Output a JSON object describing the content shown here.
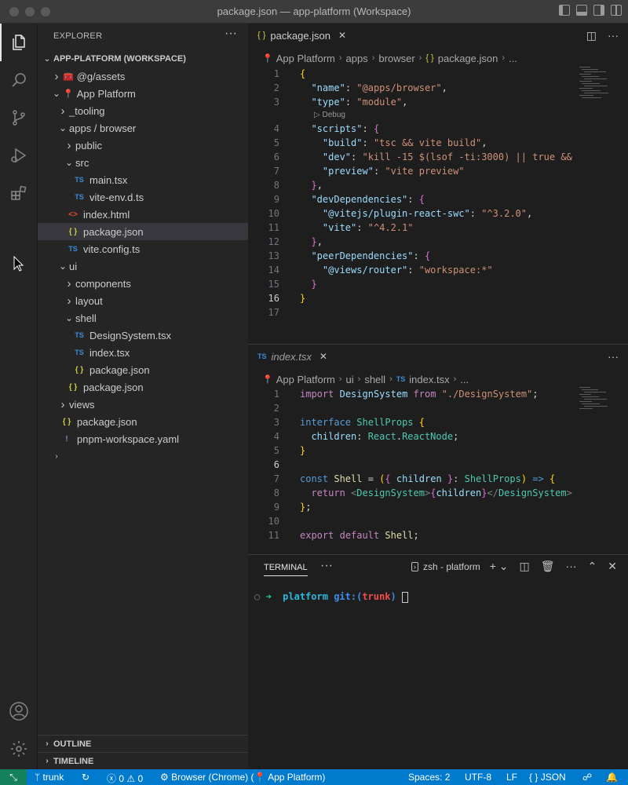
{
  "window": {
    "title": "package.json — app-platform (Workspace)"
  },
  "explorer": {
    "title": "EXPLORER",
    "more": "···",
    "workspace": "APP-PLATFORM (WORKSPACE)",
    "tree": [
      {
        "label": "@g/assets",
        "kind": "folder",
        "icon": "🧰"
      },
      {
        "label": "App Platform",
        "kind": "folder-open",
        "icon": "📍"
      },
      {
        "label": "_tooling",
        "kind": "folder"
      },
      {
        "label": "apps / browser",
        "kind": "folder-open"
      },
      {
        "label": "public",
        "kind": "folder"
      },
      {
        "label": "src",
        "kind": "folder-open"
      },
      {
        "label": "main.tsx",
        "kind": "ts"
      },
      {
        "label": "vite-env.d.ts",
        "kind": "ts"
      },
      {
        "label": "index.html",
        "kind": "html"
      },
      {
        "label": "package.json",
        "kind": "json"
      },
      {
        "label": "vite.config.ts",
        "kind": "ts"
      },
      {
        "label": "ui",
        "kind": "folder-open"
      },
      {
        "label": "components",
        "kind": "folder"
      },
      {
        "label": "layout",
        "kind": "folder"
      },
      {
        "label": "shell",
        "kind": "folder-open"
      },
      {
        "label": "DesignSystem.tsx",
        "kind": "ts"
      },
      {
        "label": "index.tsx",
        "kind": "ts"
      },
      {
        "label": "package.json",
        "kind": "json"
      },
      {
        "label": "package.json",
        "kind": "json"
      },
      {
        "label": "views",
        "kind": "folder"
      },
      {
        "label": "package.json",
        "kind": "json"
      },
      {
        "label": "pnpm-workspace.yaml",
        "kind": "yaml"
      }
    ],
    "outline": "OUTLINE",
    "timeline": "TIMELINE"
  },
  "icons": {
    "ts": "TS",
    "json": "{ }",
    "html": "<>",
    "yaml": "!",
    "chevron_right": "›",
    "chevron_down": "⌄"
  },
  "editor_top": {
    "tab": "package.json",
    "breadcrumb": [
      "App Platform",
      "apps",
      "browser",
      "package.json",
      "..."
    ],
    "codelens": "▷ Debug",
    "line_numbers": [
      "1",
      "2",
      "3",
      "4",
      "5",
      "6",
      "7",
      "8",
      "9",
      "10",
      "11",
      "12",
      "13",
      "14",
      "15",
      "16",
      "17"
    ],
    "current_line": "16"
  },
  "editor_bottom": {
    "tab": "index.tsx",
    "breadcrumb": [
      "App Platform",
      "ui",
      "shell",
      "index.tsx",
      "..."
    ],
    "line_numbers": [
      "1",
      "2",
      "3",
      "4",
      "5",
      "6",
      "7",
      "8",
      "9",
      "10",
      "11"
    ],
    "current_line": "6"
  },
  "terminal": {
    "tab": "TERMINAL",
    "more": "···",
    "shell": "zsh - platform",
    "prompt_dir": "platform",
    "prompt_git": "git:(",
    "prompt_branch": "trunk",
    "prompt_git_close": ")"
  },
  "statusbar": {
    "branch": "trunk",
    "errors": "0",
    "warnings": "0",
    "debug": "Browser (Chrome) (📍 App Platform)",
    "spaces": "Spaces: 2",
    "encoding": "UTF-8",
    "eol": "LF",
    "language": "JSON"
  },
  "colors": {
    "accent": "#007acc",
    "remote": "#16825d",
    "selected_row": "#37373d"
  }
}
